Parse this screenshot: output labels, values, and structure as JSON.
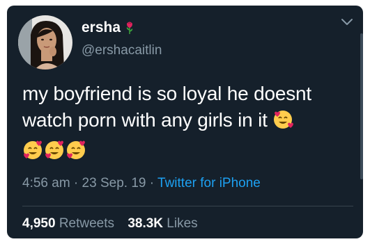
{
  "tweet": {
    "display_name": "ersha",
    "handle": "@ershacaitlin",
    "text": "my boyfriend is so loyal he doesnt watch porn with any girls in it",
    "time": "4:56 am",
    "date": "23 Sep. 19",
    "separator": " · ",
    "source": "Twitter for iPhone",
    "retweets_count": "4,950",
    "retweets_label": "Retweets",
    "likes_count": "38.3K",
    "likes_label": "Likes",
    "inline_emoji": "smiling-face-with-hearts",
    "trailing_emojis": [
      "smiling-face-with-hearts",
      "smiling-face-with-hearts",
      "smiling-face-with-hearts"
    ]
  },
  "icons": {
    "name_badge": "rose-icon",
    "menu": "chevron-down-icon"
  },
  "colors": {
    "background": "#15202b",
    "text": "#ffffff",
    "secondary": "#8899a6",
    "link": "#1da1f2"
  }
}
